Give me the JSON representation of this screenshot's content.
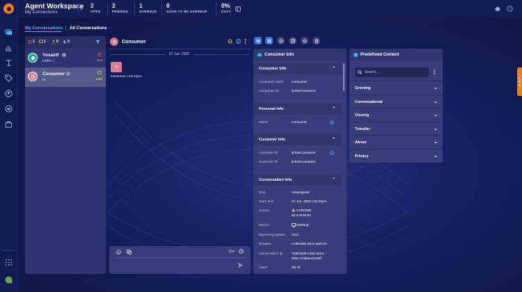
{
  "header": {
    "title": "Agent Workspace",
    "subtitle": "My Connections",
    "stats": [
      {
        "value": "2",
        "label": "OPEN"
      },
      {
        "value": "2",
        "label": "PENDING"
      },
      {
        "value": "1",
        "label": "OVERDUE"
      },
      {
        "value": "0",
        "label": "SOON TO BE OVERDUE"
      },
      {
        "value": "0%",
        "label": "CSAT"
      }
    ]
  },
  "tabs": {
    "my_conversations": "My Conversations",
    "all_conversations": "All Conversations"
  },
  "filters": [
    {
      "icon": "alarm-icon",
      "count": "1",
      "color": "#f25561"
    },
    {
      "icon": "chat-icon",
      "count": "1",
      "color": "#f0d236"
    },
    {
      "icon": "person-icon",
      "count": "0",
      "color": "#f07b1d"
    },
    {
      "icon": "moon-icon",
      "count": "0",
      "color": "#8fd0f0"
    }
  ],
  "conversations": [
    {
      "name": "Yossirif",
      "message": "Hello :)",
      "time": "24s",
      "avatar_color": "#1aa89c",
      "time_color": "#f25561"
    },
    {
      "name": "Consumer",
      "message": "hi",
      "time": "10m",
      "avatar_color": "#e07d93",
      "time_color": "#c4d24a"
    }
  ],
  "chat": {
    "title": "Consumer",
    "date": "07 Jun. 2020",
    "message": "hi",
    "meta": "Consumer  |  04:24pm",
    "timer": "10m"
  },
  "consumer_info": {
    "title": "Consumer Info",
    "sections": {
      "consumer": {
        "title": "Consumer Info",
        "rows": [
          {
            "label": "Consumer name",
            "value": "Consumer"
          },
          {
            "label": "Consumer ID",
            "value": "lpTestConsumer"
          }
        ]
      },
      "personal": {
        "title": "Personal Info",
        "rows": [
          {
            "label": "Name",
            "value": "Consumer"
          }
        ]
      },
      "customer": {
        "title": "Customer Info",
        "rows": [
          {
            "label": "Customer ID",
            "value": "lpTestConsumer"
          },
          {
            "label": "Customer ID",
            "value": "lpTestConsumer"
          }
        ]
      },
      "conversation": {
        "title": "Conversation Info",
        "rows": [
          {
            "label": "Skill",
            "value": "Unassigned"
          },
          {
            "label": "Start time",
            "value": "07 Jun. 2020 | 04:24pm"
          },
          {
            "label": "Source",
            "value": "CHROME",
            "value2": "83.0.4103.61"
          },
          {
            "label": "Device",
            "value": "Desktop"
          },
          {
            "label": "Operating System",
            "value": "OSX"
          },
          {
            "label": "Browser",
            "value": "CHROME 83.0.4103.61"
          },
          {
            "label": "Conversation ID",
            "value": "7d801839-c032-4e1a-",
            "value2": "91bc-37de9e44166f"
          },
          {
            "label": "CSAT",
            "value": "0/5 ★"
          }
        ]
      }
    }
  },
  "predefined": {
    "title": "Predefined Content",
    "search_placeholder": "Search...",
    "items": [
      "Greeting",
      "Conversational",
      "Closing",
      "Transfer",
      "Abuse",
      "Privacy"
    ]
  }
}
